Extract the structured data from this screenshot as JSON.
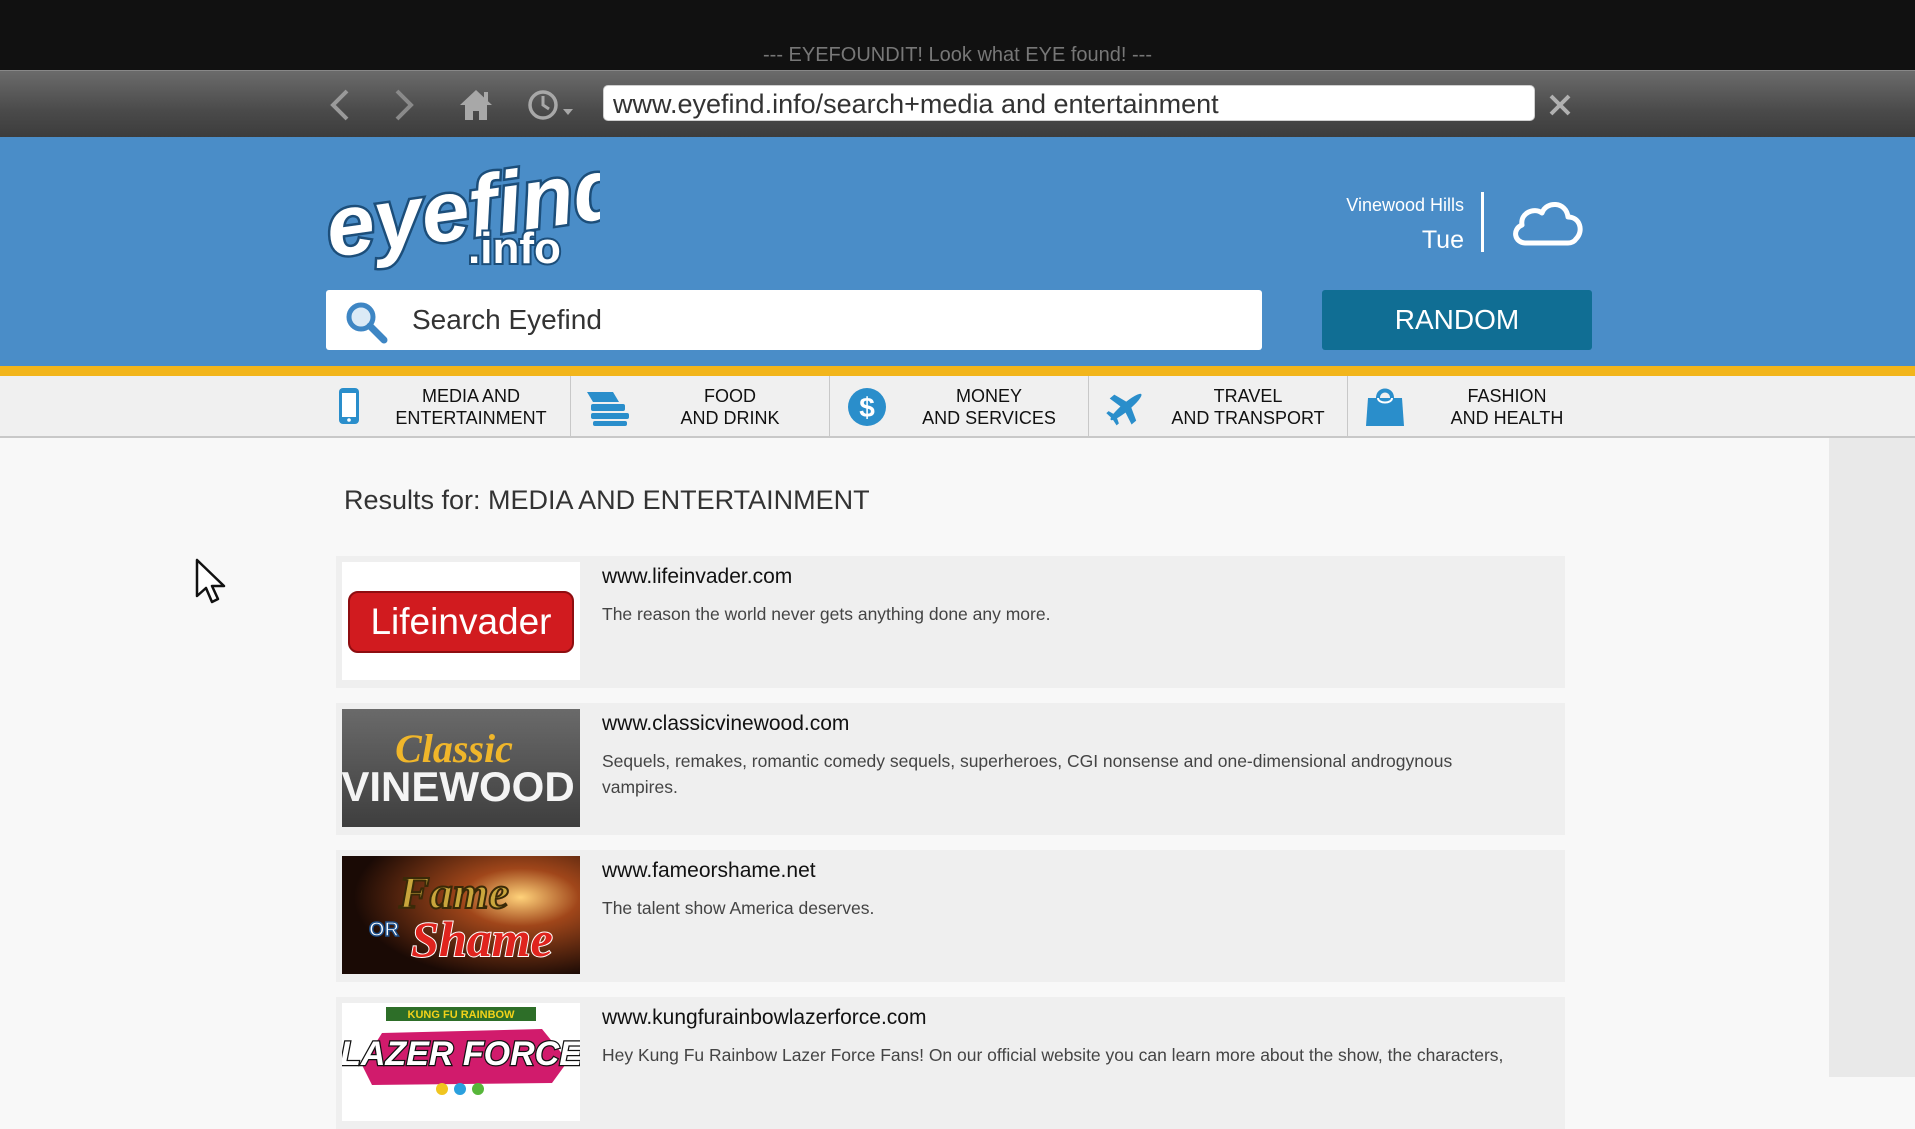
{
  "window": {
    "title": "--- EYEFOUNDIT! Look what EYE found! ---"
  },
  "toolbar": {
    "url": "www.eyefind.info/search+media and entertainment",
    "icons": [
      "back-arrow-icon",
      "forward-arrow-icon",
      "home-icon",
      "history-clock-icon",
      "close-icon"
    ]
  },
  "header": {
    "logo": {
      "main": "eyefind",
      "sub": ".info"
    },
    "location": "Vinewood Hills",
    "day": "Tue",
    "weather_icon": "cloud-icon",
    "search_placeholder": "Search Eyefind",
    "random_label": "RANDOM"
  },
  "categories": [
    {
      "line1": "MEDIA AND",
      "line2": "ENTERTAINMENT",
      "icon": "tablet-icon"
    },
    {
      "line1": "FOOD",
      "line2": "AND DRINK",
      "icon": "food-icon"
    },
    {
      "line1": "MONEY",
      "line2": "AND SERVICES",
      "icon": "dollar-icon"
    },
    {
      "line1": "TRAVEL",
      "line2": "AND TRANSPORT",
      "icon": "airplane-icon"
    },
    {
      "line1": "FASHION",
      "line2": "AND HEALTH",
      "icon": "shopping-bag-icon"
    }
  ],
  "results_title": "Results for: MEDIA AND ENTERTAINMENT",
  "results": [
    {
      "url": "www.lifeinvader.com",
      "desc": "The reason the world never gets anything done any more.",
      "logo_text": "Lifeinvader"
    },
    {
      "url": "www.classicvinewood.com",
      "desc": "Sequels, remakes, romantic comedy sequels, superheroes, CGI nonsense and one-dimensional androgynous vampires.",
      "logo_text": "Classic VINEWOOD"
    },
    {
      "url": "www.fameorshame.net",
      "desc": "The talent show America deserves.",
      "logo_text": "Fame OR Shame"
    },
    {
      "url": "www.kungfurainbowlazerforce.com",
      "desc": "Hey Kung Fu Rainbow Lazer Force Fans! On our official website you can learn more about the show, the characters,",
      "logo_text": "KUNG FU RAINBOW LAZER FORCE"
    }
  ],
  "colors": {
    "header_blue": "#4a8dc8",
    "random_button": "#106e94",
    "stripe": "#f2b51b",
    "category_icon": "#2a8ecb"
  }
}
